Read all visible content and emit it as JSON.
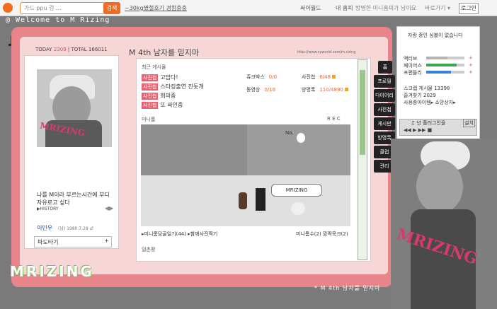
{
  "topbar": {
    "search_placeholder": "가드 ppu 검 ...",
    "search_btn": "검색",
    "link": "~30kg쪘철호기 경험충충",
    "nav": [
      "싸이월드",
      "내 홈피",
      "방명한 미니홈피가 남이요",
      "바로가기 ▾"
    ],
    "login": "로그인"
  },
  "welcome": "@ Welcome to M Rizing",
  "counter": {
    "today_label": "TODAY",
    "today": "2309",
    "total_label": "TOTAL",
    "total": "166011"
  },
  "profile": {
    "intro": "나를 M이라 부르는시간에 \n부디 자유로고 싶다",
    "history": "▶HISTORY",
    "name": "이민우",
    "birth": "(남) 1980.7.28 ♂",
    "dropdown": "파도타기",
    "dropdown_icon": "+"
  },
  "homepage": {
    "title": "M 4th 남자를 믿지마",
    "url": "http://www.cyworld.com/m.rizing"
  },
  "recent": {
    "title": "최근 게시물",
    "items": [
      {
        "tag": "사진첩",
        "text": "고맙다!"
      },
      {
        "tag": "사진첩",
        "text": "스타킹출연 진돗개"
      },
      {
        "tag": "사진첩",
        "text": "회의중"
      },
      {
        "tag": "사진첩",
        "text": "또 싸인중"
      }
    ],
    "stats": [
      {
        "label": "쥬크박스",
        "value": "0/0"
      },
      {
        "label": "사진첩",
        "value": "6/48"
      },
      {
        "label": "동영상",
        "value": "0/18"
      },
      {
        "label": "방명록",
        "value": "110/4890"
      }
    ]
  },
  "miniroom": {
    "title": "미니룸",
    "rec": "R E C",
    "banner": "MRIZING",
    "no_sign": "No.",
    "links": [
      "▸미니룸담골일기(44)",
      "▸함께사진찍기"
    ],
    "links_right": [
      "미니룸수(2)",
      "깜짝묵크(2)"
    ]
  },
  "ilchon": "일촌평",
  "tabs": [
    "홈",
    "프로필",
    "다이어리",
    "사진첩",
    "게시판",
    "방명록",
    "클럽",
    "관리"
  ],
  "right": {
    "title": "자랑 중인 심볼이 없습니다",
    "attrs": [
      {
        "label": "액티브",
        "value": 0.55,
        "color": "#b3b3b3"
      },
      {
        "label": "페이머스",
        "value": 0.8,
        "color": "#3aa84a"
      },
      {
        "label": "프랜들리",
        "value": 0.65,
        "color": "#3a7fd8"
      }
    ],
    "scrap": "스크랩 게시물 13398",
    "favorite": "즐겨찾기 2029",
    "history": "사용중아이템▸ 소망상자▸",
    "player_label": "♫ 넌 플러그인을",
    "player_btn": "설치",
    "player_ctrl": "◀◀ ▶ ▶▶ ■"
  },
  "footer": "* M 4th 남자를 믿지마",
  "brand": "MRIZING"
}
